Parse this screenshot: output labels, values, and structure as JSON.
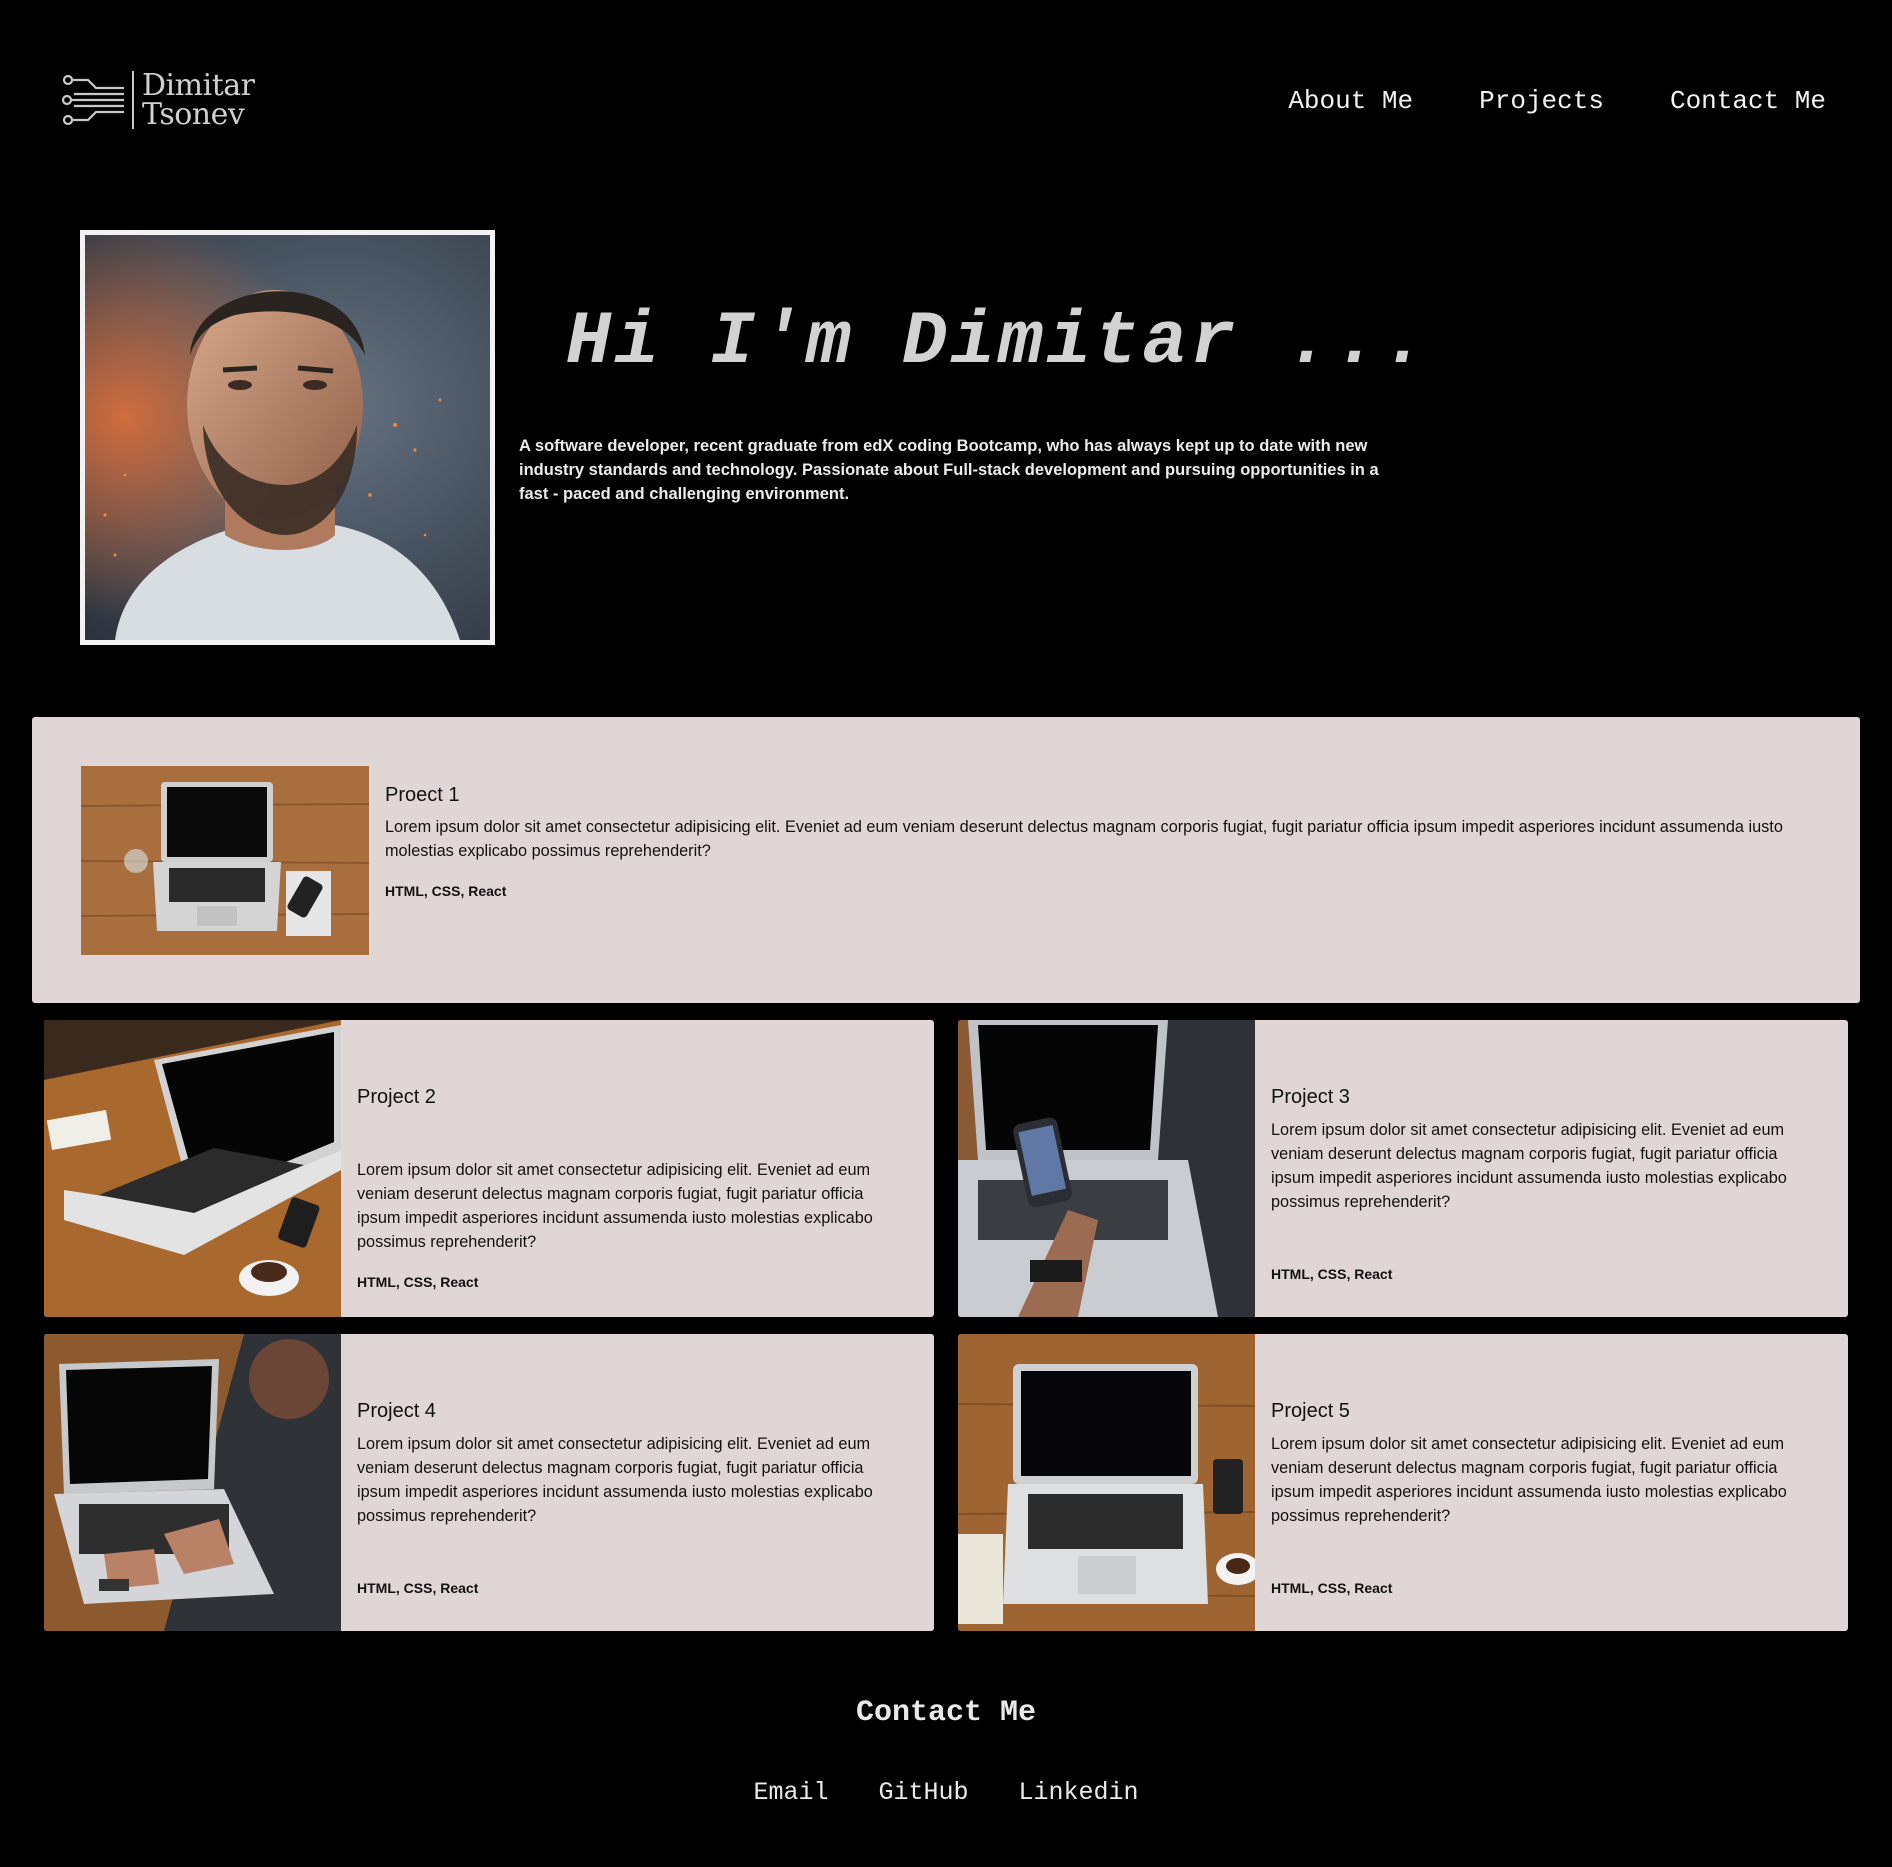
{
  "header": {
    "logo": {
      "line1": "Dimitar",
      "line2": "Tsonev",
      "icon": "circuit-icon"
    },
    "nav": [
      {
        "label": "About Me"
      },
      {
        "label": "Projects"
      },
      {
        "label": "Contact Me"
      }
    ]
  },
  "hero": {
    "title": "Hi I'm Dimitar ...",
    "description": "A software developer, recent graduate from edX coding Bootcamp, who has always kept up to date with new industry standards and technology. Passionate about Full-stack development and pursuing opportunities in a fast - paced and challenging environment.",
    "portrait": "portrait-photo"
  },
  "projects": [
    {
      "title": "Proect 1",
      "description": "Lorem ipsum dolor sit amet consectetur adipisicing elit. Eveniet ad eum veniam deserunt delectus magnam corporis fugiat, fugit pariatur officia ipsum impedit asperiores incidunt assumenda iusto molestias explicabo possimus reprehenderit?",
      "tags": "HTML, CSS, React"
    },
    {
      "title": "Project 2",
      "description": "Lorem ipsum dolor sit amet consectetur adipisicing elit. Eveniet ad eum veniam deserunt delectus magnam corporis fugiat, fugit pariatur officia ipsum impedit asperiores incidunt assumenda iusto molestias explicabo possimus reprehenderit?",
      "tags": "HTML, CSS, React"
    },
    {
      "title": "Project 3",
      "description": "Lorem ipsum dolor sit amet consectetur adipisicing elit. Eveniet ad eum veniam deserunt delectus magnam corporis fugiat, fugit pariatur officia ipsum impedit asperiores incidunt assumenda iusto molestias explicabo possimus reprehenderit?",
      "tags": "HTML, CSS, React"
    },
    {
      "title": "Project 4",
      "description": "Lorem ipsum dolor sit amet consectetur adipisicing elit. Eveniet ad eum veniam deserunt delectus magnam corporis fugiat, fugit pariatur officia ipsum impedit asperiores incidunt assumenda iusto molestias explicabo possimus reprehenderit?",
      "tags": "HTML, CSS, React"
    },
    {
      "title": "Project 5",
      "description": "Lorem ipsum dolor sit amet consectetur adipisicing elit. Eveniet ad eum veniam deserunt delectus magnam corporis fugiat, fugit pariatur officia ipsum impedit asperiores incidunt assumenda iusto molestias explicabo possimus reprehenderit?",
      "tags": "HTML, CSS, React"
    }
  ],
  "contact": {
    "title": "Contact Me",
    "links": [
      {
        "label": "Email"
      },
      {
        "label": "GitHub"
      },
      {
        "label": "Linkedin"
      }
    ]
  },
  "colors": {
    "background": "#000000",
    "card": "#e1d6d6",
    "text_light": "#f2f2f2"
  }
}
